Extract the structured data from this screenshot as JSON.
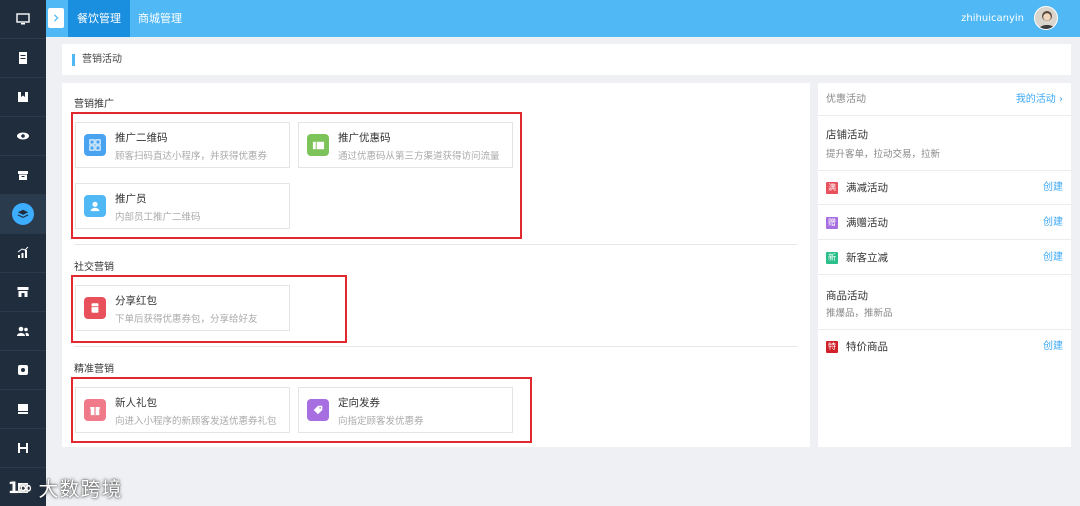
{
  "topbar": {
    "tabs": [
      {
        "label": "餐饮管理",
        "active": true
      },
      {
        "label": "商城管理",
        "active": false
      }
    ],
    "username": "zhihuicanyin"
  },
  "sidebar": {
    "items": [
      "monitor-icon",
      "document-icon",
      "bookmark-icon",
      "eye-icon",
      "box-icon",
      "layers-icon",
      "chart-icon",
      "store-icon",
      "users-icon",
      "settings-icon",
      "book-icon",
      "save-icon",
      "add-icon"
    ],
    "active_index": 5
  },
  "breadcrumb": {
    "title": "营销活动"
  },
  "main": {
    "sections": [
      {
        "title": "营销推广",
        "cards": [
          {
            "title": "推广二维码",
            "desc": "顾客扫码直达小程序，并获得优惠券",
            "icon": "qrcode-icon",
            "color": "#4aa3f0"
          },
          {
            "title": "推广优惠码",
            "desc": "通过优惠码从第三方渠道获得访问流量",
            "icon": "ticket-icon",
            "color": "#7cc45a"
          },
          {
            "title": "推广员",
            "desc": "内部员工推广二维码",
            "icon": "person-icon",
            "color": "#4fb8f5"
          }
        ]
      },
      {
        "title": "社交营销",
        "cards": [
          {
            "title": "分享红包",
            "desc": "下单后获得优惠券包，分享给好友",
            "icon": "redpacket-icon",
            "color": "#e8505b"
          }
        ]
      },
      {
        "title": "精准营销",
        "cards": [
          {
            "title": "新人礼包",
            "desc": "向进入小程序的新顾客发送优惠券礼包",
            "icon": "gift-icon",
            "color": "#f07a8a"
          },
          {
            "title": "定向发券",
            "desc": "向指定顾客发优惠券",
            "icon": "tag-icon",
            "color": "#a66ee0"
          }
        ]
      }
    ]
  },
  "side": {
    "header": {
      "title": "优惠活动",
      "link": "我的活动 ›"
    },
    "shop_group": {
      "title": "店铺活动",
      "sub": "提升客单，拉动交易，拉新"
    },
    "shop_items": [
      {
        "badge": "满",
        "name": "满减活动",
        "action": "创建",
        "color": "#e8505b"
      },
      {
        "badge": "赠",
        "name": "满赠活动",
        "action": "创建",
        "color": "#a66ee0"
      },
      {
        "badge": "新",
        "name": "新客立减",
        "action": "创建",
        "color": "#2bbf8a"
      }
    ],
    "goods_group": {
      "title": "商品活动",
      "sub": "推爆品，推新品"
    },
    "goods_items": [
      {
        "badge": "特",
        "name": "特价商品",
        "action": "创建",
        "color": "#d0202a"
      }
    ]
  },
  "watermark": {
    "logo": "1∞",
    "name": "大数跨境"
  }
}
